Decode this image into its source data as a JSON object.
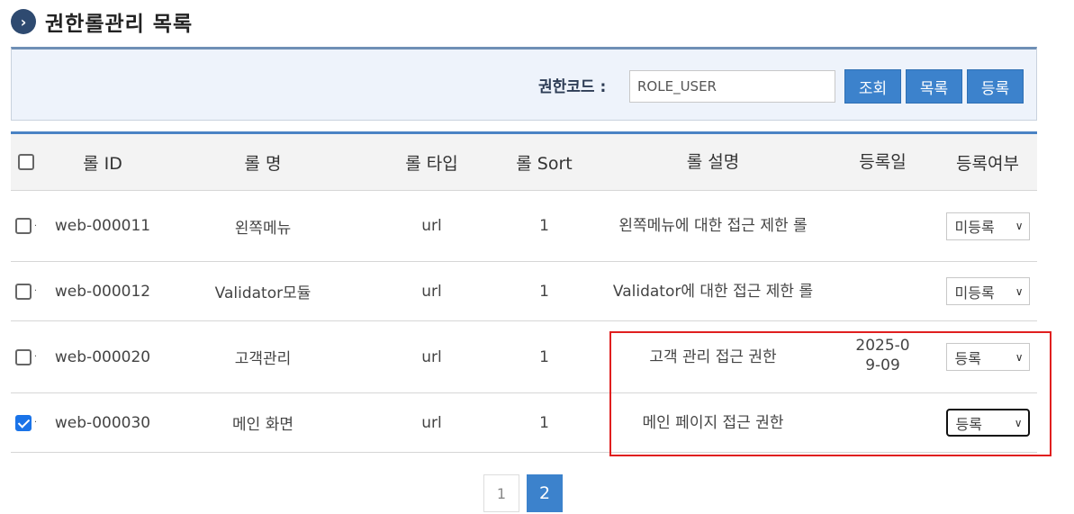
{
  "page": {
    "title": "권한롤관리 목록",
    "title_icon": "chevron-right-circle-icon"
  },
  "search": {
    "label": "권한코드 :",
    "value": "ROLE_USER",
    "buttons": {
      "search": "조회",
      "list": "목록",
      "register": "등록"
    }
  },
  "table": {
    "headers": {
      "id": "롤 ID",
      "name": "롤 명",
      "type": "롤 타입",
      "sort": "롤 Sort",
      "desc": "롤 설명",
      "date": "등록일",
      "registered": "등록여부"
    },
    "rows": [
      {
        "id": "web-000011",
        "name": "왼쪽메뉴",
        "type": "url",
        "sort": "1",
        "desc": "왼쪽메뉴에 대한 접근 제한 롤",
        "date": "",
        "registered": "미등록",
        "checked": false
      },
      {
        "id": "web-000012",
        "name": "Validator모듈",
        "type": "url",
        "sort": "1",
        "desc": "Validator에 대한 접근 제한 롤",
        "date": "",
        "registered": "미등록",
        "checked": false
      },
      {
        "id": "web-000020",
        "name": "고객관리",
        "type": "url",
        "sort": "1",
        "desc": "고객 관리 접근 권한",
        "date": "2025-09-09",
        "registered": "등록",
        "checked": false
      },
      {
        "id": "web-000030",
        "name": "메인 화면",
        "type": "url",
        "sort": "1",
        "desc": "메인 페이지 접근 권한",
        "date": "",
        "registered": "등록",
        "checked": true
      }
    ]
  },
  "pagination": {
    "pages": [
      "1",
      "2"
    ],
    "current": "2"
  },
  "colors": {
    "accent": "#3c82cc",
    "highlight": "#e01f1f",
    "title_icon": "#2e4a70"
  }
}
